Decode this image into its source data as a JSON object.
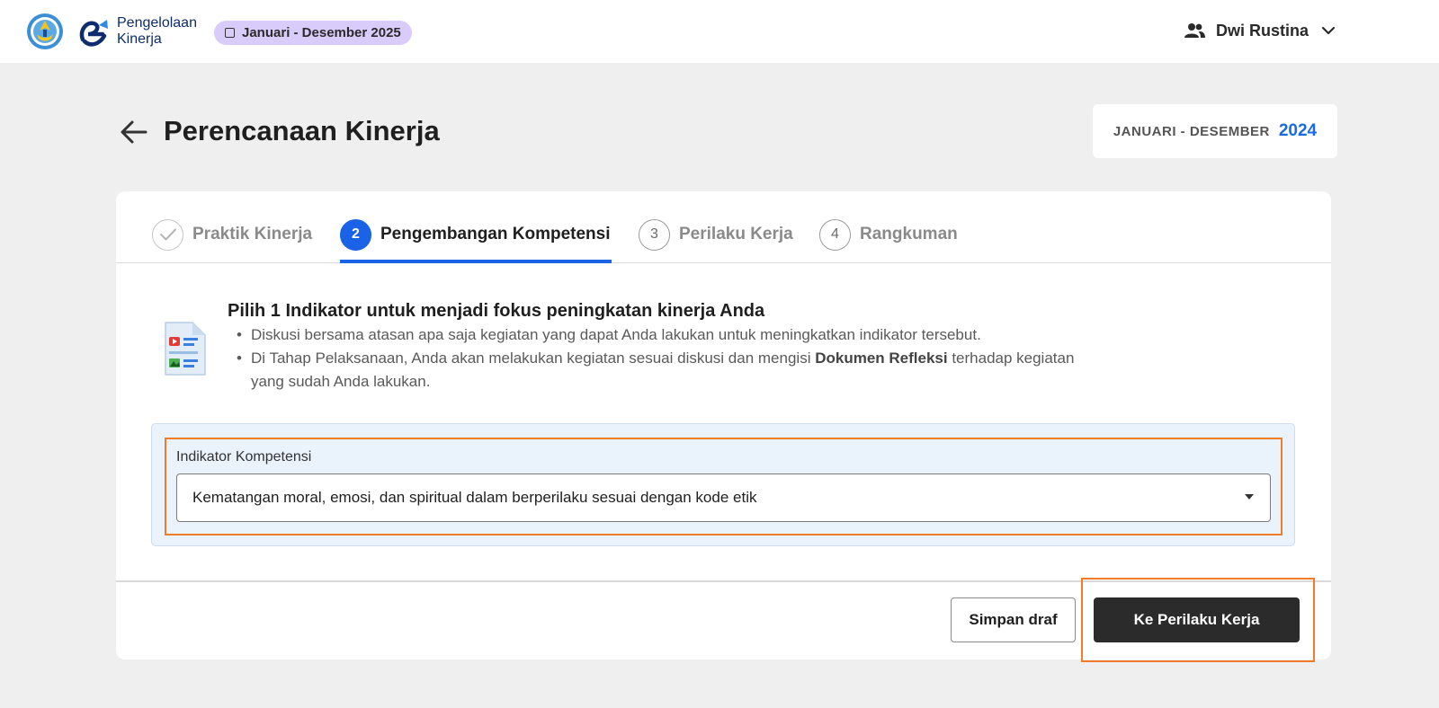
{
  "header": {
    "app_name_line1": "Pengelolaan",
    "app_name_line2": "Kinerja",
    "period_chip": "Januari - Desember 2025",
    "user_name": "Dwi Rustina"
  },
  "page": {
    "title": "Perencanaan Kinerja",
    "period_label": "JANUARI - DESEMBER",
    "period_year": "2024"
  },
  "stepper": {
    "steps": [
      {
        "number": "",
        "label": "Praktik Kinerja",
        "state": "done"
      },
      {
        "number": "2",
        "label": "Pengembangan Kompetensi",
        "state": "active"
      },
      {
        "number": "3",
        "label": "Perilaku Kerja",
        "state": "todo"
      },
      {
        "number": "4",
        "label": "Rangkuman",
        "state": "todo"
      }
    ]
  },
  "intro": {
    "title": "Pilih 1 Indikator untuk menjadi fokus peningkatan kinerja Anda",
    "bullet1": "Diskusi bersama atasan apa saja kegiatan yang dapat Anda lakukan untuk meningkatkan indikator tersebut.",
    "bullet2_before": "Di Tahap Pelaksanaan, Anda akan melakukan kegiatan sesuai diskusi dan mengisi ",
    "bullet2_bold": "Dokumen Refleksi",
    "bullet2_after": " terhadap kegiatan yang sudah Anda lakukan."
  },
  "field": {
    "label": "Indikator Kompetensi",
    "value": "Kematangan moral, emosi, dan spiritual dalam berperilaku sesuai dengan kode etik"
  },
  "footer": {
    "save_draft": "Simpan draf",
    "next": "Ke Perilaku Kerja"
  },
  "colors": {
    "accent": "#1a63e6",
    "highlight": "#f07c2a",
    "primary_button": "#2b2b2b",
    "chip_bg": "#d9ccfb"
  },
  "icons": {
    "ministry_logo": "tut-wuri-handayani-logo",
    "app_logo": "e-kinerja-logo",
    "user": "users-icon",
    "chevron": "chevron-down-icon",
    "back": "arrow-left-icon",
    "done": "check-icon",
    "document": "document-media-icon",
    "select": "caret-down-icon"
  }
}
